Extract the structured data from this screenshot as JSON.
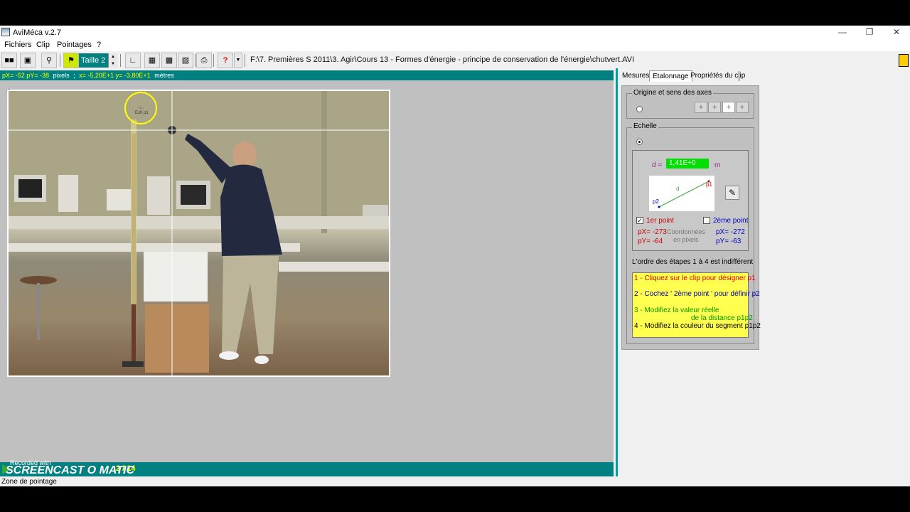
{
  "window": {
    "title": "AviMéca v.2.7"
  },
  "menu": [
    "Fichiers",
    "Clip",
    "Pointages",
    "?"
  ],
  "toolbar": {
    "taille_label": "Taille 2",
    "file_path": "F:\\7. Premières S 2011\\3. Agir\\Cours 13 - Formes d'énergie - principe de conservation de l'énergie\\chutvert.AVI"
  },
  "coords": {
    "pixels": "pX= -52  pY= -38",
    "pixels_unit": "pixels",
    "separator": ";",
    "meters": "x= -5,20E+1   y= -3,80E+1",
    "meters_unit": "mètres"
  },
  "video": {
    "marker_label": "Ech p1"
  },
  "playback": {
    "frame_counter": "2 / 14"
  },
  "watermark": {
    "top": "Recorded with",
    "brand": "SCREENCAST O MATIC"
  },
  "status": {
    "text": "Zone de pointage"
  },
  "tabs": [
    {
      "label": "Mesures"
    },
    {
      "label": "Etalonnage"
    },
    {
      "label": "Propriétés du clip"
    }
  ],
  "calibration": {
    "origin_group": "Origine et sens des axes",
    "scale_group": "Echelle",
    "d_label": "d =",
    "d_value": "1,41E+0",
    "d_unit": "m",
    "diagram": {
      "p1": "p1",
      "p2": "p2",
      "d": "d"
    },
    "point1": {
      "label": "1er point",
      "px": "pX= -273",
      "py": "pY= -64"
    },
    "point2": {
      "label": "2ème point",
      "px": "pX= -272",
      "py": "pY= -63"
    },
    "coords_caption_1": "Coordonnées",
    "coords_caption_2": "en pixels",
    "order_note": "L'ordre des étapes 1 à 4 est indifférent",
    "steps": [
      "1 - Cliquez sur le clip pour désigner p1",
      "2 - Cochez ' 2ème point ' pour définir p2",
      "3 - Modifiez la valeur réelle",
      "de la distance p1p2",
      "4 - Modifiez la couleur du segment p1p2"
    ]
  },
  "colors": {
    "teal": "#008080",
    "highlight": "#ffff50",
    "value_green": "#00e000"
  }
}
